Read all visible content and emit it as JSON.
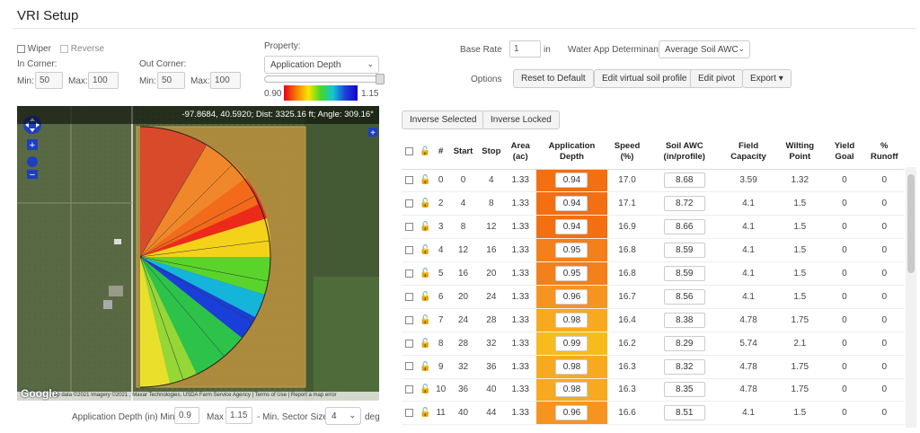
{
  "page_title": "VRI Setup",
  "controls": {
    "wiper_label": "Wiper",
    "reverse_label": "Reverse",
    "in_corner_label": "In Corner:",
    "out_corner_label": "Out Corner:",
    "min_label": "Min:",
    "max_label": "Max:",
    "in_min": "50",
    "in_max": "100",
    "out_min": "50",
    "out_max": "100",
    "property_label": "Property:",
    "property_value": "Application Depth",
    "legend_min": "0.90",
    "legend_max": "1.15"
  },
  "rate": {
    "base_rate_label": "Base Rate",
    "base_rate_value": "1",
    "unit": "in",
    "water_app_label": "Water App Determinant",
    "water_app_value": "Average Soil AWC"
  },
  "options": {
    "label": "Options",
    "reset": "Reset to Default",
    "edit_soil": "Edit virtual soil profile",
    "edit_pivot": "Edit pivot",
    "export": "Export"
  },
  "selection": {
    "inverse_selected": "Inverse Selected",
    "inverse_locked": "Inverse Locked"
  },
  "map": {
    "coord_text": "-97.8684, 40.5920; Dist: 3325.16 ft; Angle: 309.16°",
    "footer_text": "Map data ©2021 Imagery ©2021 , Maxar Technologies, USDA Farm Service Agency  |  Terms of Use  |  Report a map error",
    "google": "Google"
  },
  "bottom": {
    "label": "Application Depth (in) Min",
    "min": "0.9",
    "max_label": "Max",
    "max": "1.15",
    "sector_label": "- Min. Sector Size",
    "sector": "4",
    "unit": "deg"
  },
  "table": {
    "headers": [
      "#",
      "Start",
      "Stop",
      "Area (ac)",
      "Application Depth",
      "Speed (%)",
      "Soil AWC (in/profile)",
      "Field Capacity",
      "Wilting Point",
      "Yield Goal",
      "% Runoff"
    ],
    "rows": [
      {
        "n": "0",
        "start": "0",
        "stop": "4",
        "area": "1.33",
        "depth": "0.94",
        "speed": "17.0",
        "awc": "8.68",
        "fc": "3.59",
        "wp": "1.32",
        "yg": "0",
        "ro": "0",
        "color": "#f26f12"
      },
      {
        "n": "2",
        "start": "4",
        "stop": "8",
        "area": "1.33",
        "depth": "0.94",
        "speed": "17.1",
        "awc": "8.72",
        "fc": "4.1",
        "wp": "1.5",
        "yg": "0",
        "ro": "0",
        "color": "#f26f12"
      },
      {
        "n": "3",
        "start": "8",
        "stop": "12",
        "area": "1.33",
        "depth": "0.94",
        "speed": "16.9",
        "awc": "8.66",
        "fc": "4.1",
        "wp": "1.5",
        "yg": "0",
        "ro": "0",
        "color": "#f26f12"
      },
      {
        "n": "4",
        "start": "12",
        "stop": "16",
        "area": "1.33",
        "depth": "0.95",
        "speed": "16.8",
        "awc": "8.59",
        "fc": "4.1",
        "wp": "1.5",
        "yg": "0",
        "ro": "0",
        "color": "#f3801a"
      },
      {
        "n": "5",
        "start": "16",
        "stop": "20",
        "area": "1.33",
        "depth": "0.95",
        "speed": "16.8",
        "awc": "8.59",
        "fc": "4.1",
        "wp": "1.5",
        "yg": "0",
        "ro": "0",
        "color": "#f3801a"
      },
      {
        "n": "6",
        "start": "20",
        "stop": "24",
        "area": "1.33",
        "depth": "0.96",
        "speed": "16.7",
        "awc": "8.56",
        "fc": "4.1",
        "wp": "1.5",
        "yg": "0",
        "ro": "0",
        "color": "#f69420"
      },
      {
        "n": "7",
        "start": "24",
        "stop": "28",
        "area": "1.33",
        "depth": "0.98",
        "speed": "16.4",
        "awc": "8.38",
        "fc": "4.78",
        "wp": "1.75",
        "yg": "0",
        "ro": "0",
        "color": "#f7a91f"
      },
      {
        "n": "8",
        "start": "28",
        "stop": "32",
        "area": "1.33",
        "depth": "0.99",
        "speed": "16.2",
        "awc": "8.29",
        "fc": "5.74",
        "wp": "2.1",
        "yg": "0",
        "ro": "0",
        "color": "#f8bb1c"
      },
      {
        "n": "9",
        "start": "32",
        "stop": "36",
        "area": "1.33",
        "depth": "0.98",
        "speed": "16.3",
        "awc": "8.32",
        "fc": "4.78",
        "wp": "1.75",
        "yg": "0",
        "ro": "0",
        "color": "#f7a91f"
      },
      {
        "n": "10",
        "start": "36",
        "stop": "40",
        "area": "1.33",
        "depth": "0.98",
        "speed": "16.3",
        "awc": "8.35",
        "fc": "4.78",
        "wp": "1.75",
        "yg": "0",
        "ro": "0",
        "color": "#f7a91f"
      },
      {
        "n": "11",
        "start": "40",
        "stop": "44",
        "area": "1.33",
        "depth": "0.96",
        "speed": "16.6",
        "awc": "8.51",
        "fc": "4.1",
        "wp": "1.5",
        "yg": "0",
        "ro": "0",
        "color": "#f69420"
      }
    ]
  }
}
